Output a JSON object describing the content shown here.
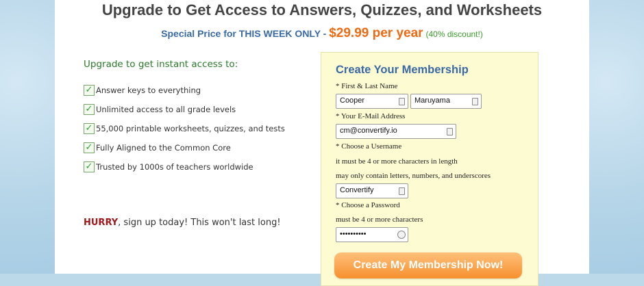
{
  "header": {
    "headline": "Upgrade to Get Access to Answers, Quizzes, and Worksheets",
    "special_text": "Special Price for THIS WEEK ONLY - ",
    "price": "$29.99 per year",
    "discount": "(40% discount!)"
  },
  "benefits": {
    "title": "Upgrade to get instant access to:",
    "items": [
      {
        "label": "Answer keys to everything"
      },
      {
        "label": "Unlimited access to all grade levels"
      },
      {
        "label": "55,000 printable worksheets, quizzes, and tests"
      },
      {
        "label": "Fully Aligned to the Common Core"
      },
      {
        "label": "Trusted by 1000s of teachers worldwide"
      }
    ],
    "hurry_word": "HURRY",
    "hurry_rest": ", sign up today! This won't last long!"
  },
  "form": {
    "title": "Create Your Membership",
    "name_label": "* First & Last Name",
    "first_name_value": "Cooper",
    "last_name_value": "Maruyama",
    "email_label": "* Your E-Mail Address",
    "email_value": "cm@convertify.io",
    "username_label": "* Choose a Username",
    "username_hint1": "it must be 4 or more characters in length",
    "username_hint2": "may only contain letters, numbers, and underscores",
    "username_value": "Convertify",
    "password_label": "* Choose a Password",
    "password_hint": "must be 4 or more characters",
    "password_value": "••••••••••",
    "submit_label": "Create My Membership Now!"
  }
}
